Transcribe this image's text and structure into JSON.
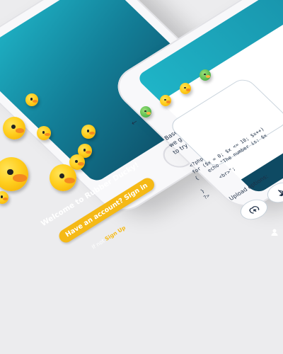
{
  "login_screen": {
    "welcome_text": "Welcome to Rubber Ducky!",
    "signin_button": "Have an account? Sign in",
    "signup_prefix": "If not",
    "signup_link": "Sign Up"
  },
  "code_screen": {
    "back_icon": "back-arrow-icon",
    "message_lines": [
      "Based on what you've said",
      "we generated this code for you",
      "to try!"
    ],
    "code_lines": [
      "<?php",
      "for ($x = 0; $x <= 10; $x++)",
      "{    echo \"The number is: $x",
      "     <br>\";",
      "}",
      "?>"
    ],
    "upload_label": "Upload options:",
    "upload_icons": [
      "cloud-upload-icon",
      "boat-icon"
    ],
    "nav_icon": "profile-icon"
  },
  "colors": {
    "teal": "#1fb4c7",
    "navy": "#0e4a63",
    "duck_yellow": "#ffcf1f",
    "button_yellow": "#f5b916",
    "text_dark": "#1e2f46"
  }
}
